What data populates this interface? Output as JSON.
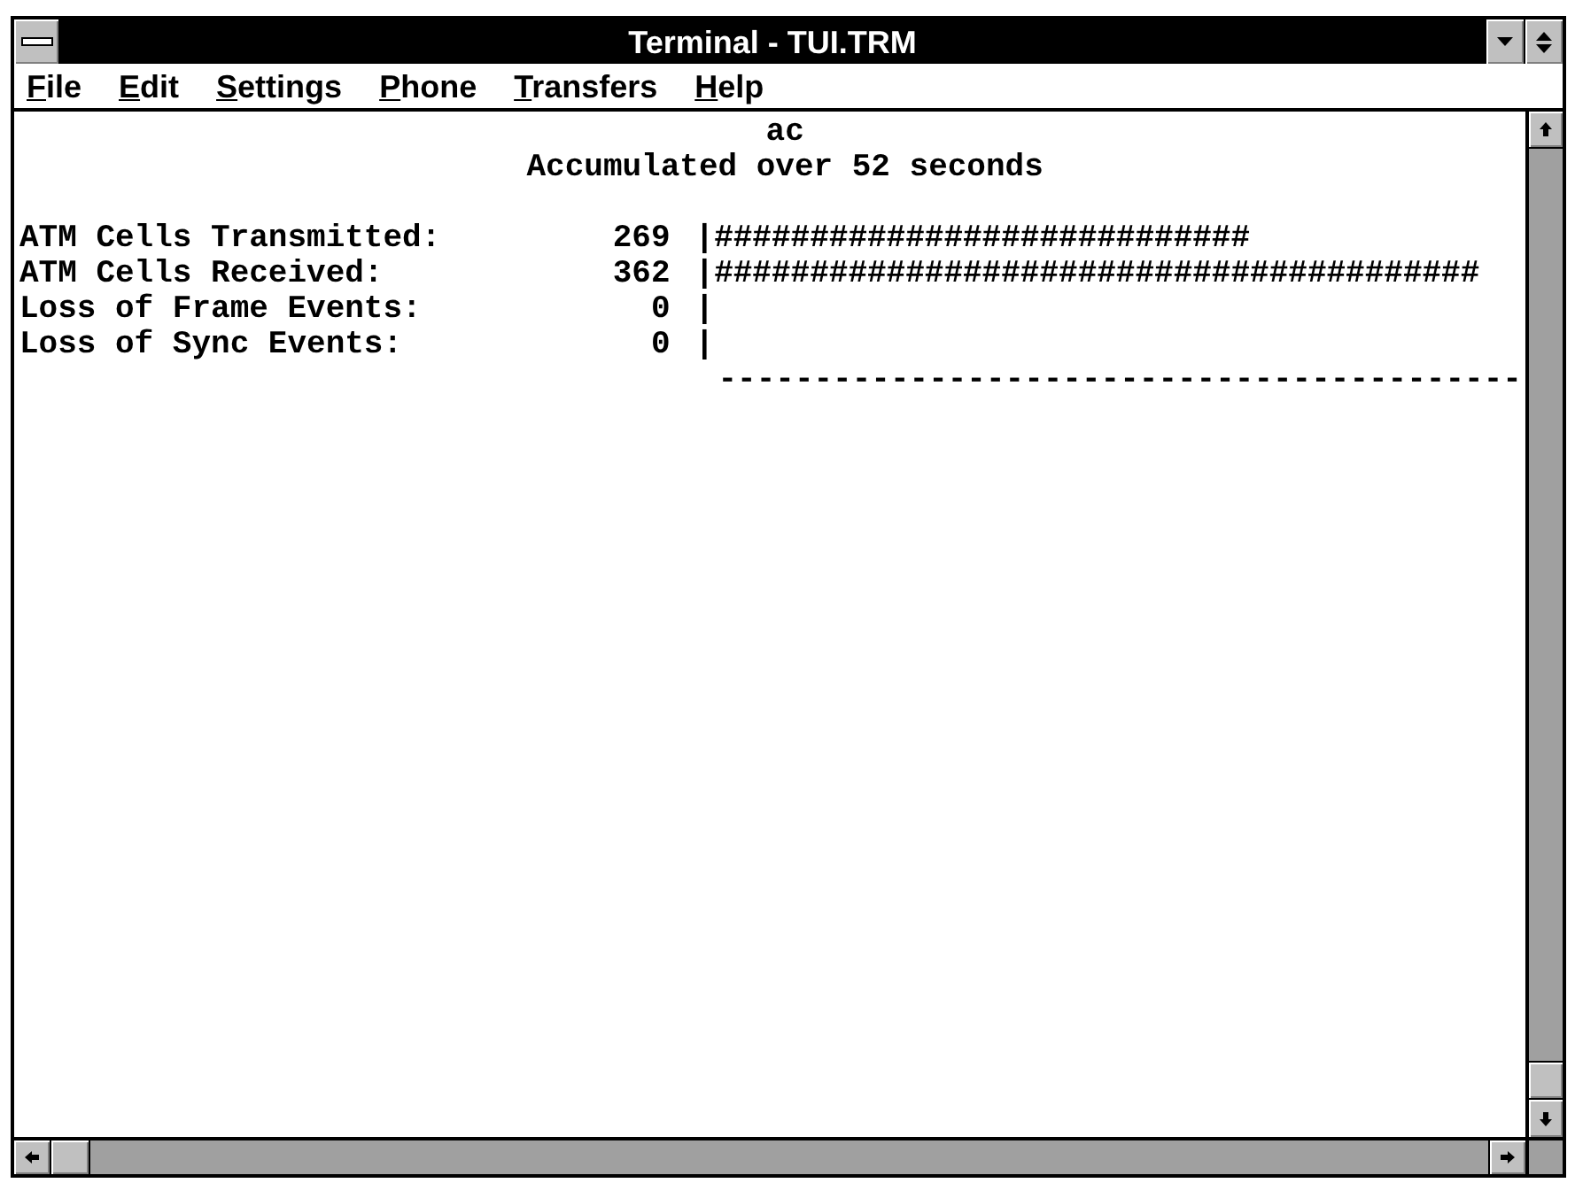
{
  "window": {
    "title": "Terminal - TUI.TRM"
  },
  "menu_bar": [
    "File",
    "Edit",
    "Settings",
    "Phone",
    "Transfers",
    "Help"
  ],
  "terminal": {
    "title": "ac",
    "subtitle": "Accumulated over 52 seconds",
    "counters": [
      {
        "label": "ATM Cells Transmitted:",
        "value": "269",
        "bar": "|############################"
      },
      {
        "label": "ATM Cells Received:",
        "value": "362",
        "bar": "|########################################"
      },
      {
        "label": "Loss of Frame Events:",
        "value": "0",
        "bar": "|"
      },
      {
        "label": "Loss of Sync Events:",
        "value": "0",
        "bar": "|"
      }
    ],
    "separator": "------------------------------------------"
  }
}
